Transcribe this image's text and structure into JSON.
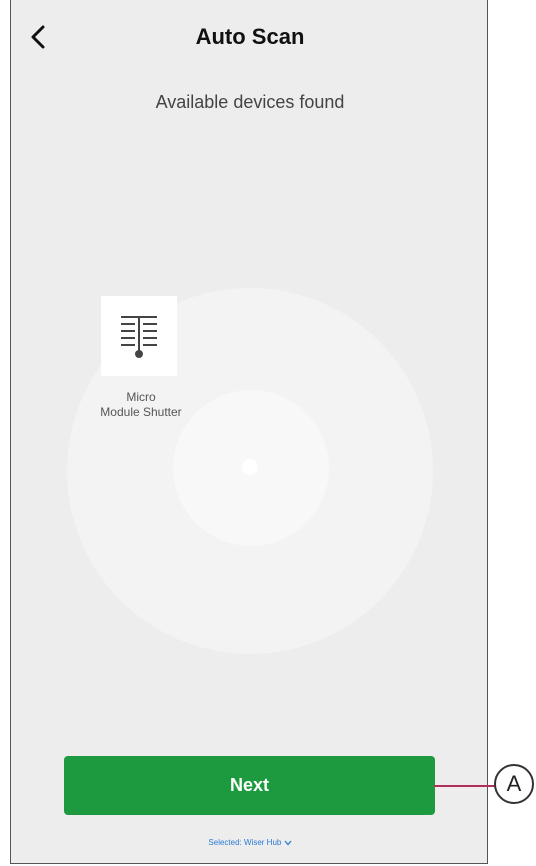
{
  "header": {
    "title": "Auto Scan",
    "subtitle": "Available devices found",
    "back_icon": "chevron-left-icon"
  },
  "devices": [
    {
      "name": "Micro\nModule Shutter",
      "icon": "shutter-icon"
    }
  ],
  "footer": {
    "next_label": "Next",
    "selected_hub": "Selected: Wiser Hub"
  },
  "annotation": {
    "callout_label": "A"
  },
  "colors": {
    "accent_green": "#1d9a3f",
    "link_blue": "#2a7bd6",
    "callout_line": "#b0305a",
    "background": "#ededed"
  }
}
